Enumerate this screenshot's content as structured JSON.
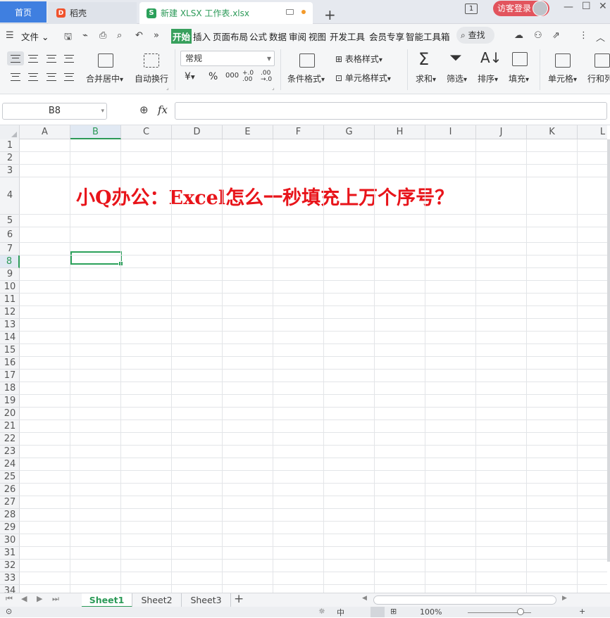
{
  "tabs": {
    "home": "首页",
    "daoke": "稻壳",
    "active_file": "新建 XLSX 工作表.xlsx",
    "badge_number": "1",
    "login": "访客登录"
  },
  "menu": {
    "file": "文件",
    "items": [
      "开始",
      "插入",
      "页面布局",
      "公式",
      "数据",
      "审阅",
      "视图",
      "开发工具",
      "会员专享",
      "智能工具箱"
    ],
    "search": "查找"
  },
  "ribbon": {
    "merge_center": "合并居中",
    "auto_wrap": "自动换行",
    "number_format": "常规",
    "currency_symbol": "¥",
    "percent_symbol": "%",
    "thousands_symbol": "000",
    "inc_decimal": "+.0 .00",
    "dec_decimal": ".00 →.0",
    "conditional_format": "条件格式",
    "table_style": "表格样式",
    "cell_style": "单元格样式",
    "sum": "求和",
    "filter": "筛选",
    "sort": "排序",
    "fill": "填充",
    "cell": "单元格",
    "row_col": "行和列"
  },
  "formula_bar": {
    "name_box": "B8",
    "fx": "fx",
    "value": ""
  },
  "grid": {
    "columns": [
      "A",
      "B",
      "C",
      "D",
      "E",
      "F",
      "G",
      "H",
      "I",
      "J",
      "K",
      "L"
    ],
    "selected_column": "B",
    "rows": [
      "1",
      "2",
      "3",
      "4",
      "5",
      "6",
      "7",
      "8",
      "9",
      "10",
      "11",
      "12",
      "13",
      "14",
      "15",
      "16",
      "17",
      "18",
      "19",
      "20",
      "21",
      "22",
      "23",
      "24",
      "25",
      "26",
      "27",
      "28",
      "29",
      "30",
      "31",
      "32",
      "33",
      "34"
    ],
    "selected_row": "8",
    "title_text": "小Q办公：Excel怎么一秒填充上万个序号？",
    "title_color": "#e8141a"
  },
  "sheets": [
    "Sheet1",
    "Sheet2",
    "Sheet3"
  ],
  "active_sheet": "Sheet1",
  "status": {
    "zoom": "100%"
  },
  "colors": {
    "accent_green": "#2c9a58",
    "home_tab_blue": "#3f7fe0",
    "login_red": "#e2545d"
  }
}
